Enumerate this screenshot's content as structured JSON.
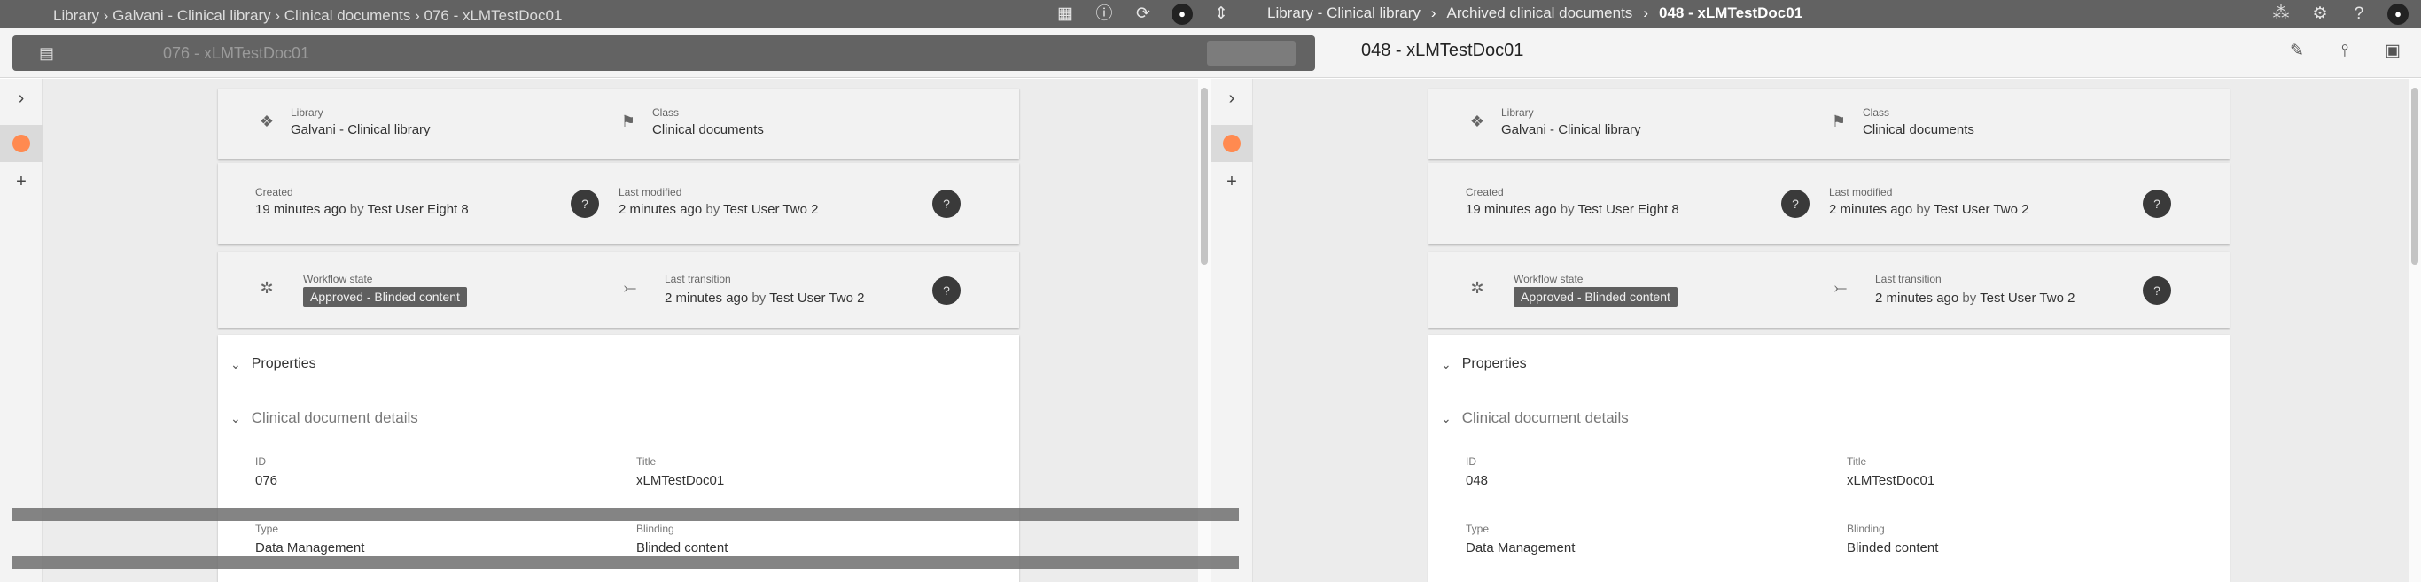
{
  "topbar": {
    "left_breadcrumb": "Library  ›  Galvani - Clinical library  ›  Clinical documents  ›  076 - xLMTestDoc01",
    "crumbs": [
      "Library - Clinical library",
      "Archived clinical documents",
      "048 - xLMTestDoc01"
    ],
    "separator": "›",
    "icons_mid": [
      "grid-icon",
      "info-icon",
      "refresh-icon",
      "avatar-icon",
      "up-down-icon"
    ],
    "icons_right": [
      "apps-icon",
      "settings-icon",
      "help-icon",
      "user-avatar-icon"
    ]
  },
  "subbar": {
    "left_title": "076 - xLMTestDoc01",
    "right_title": "048 - xLMTestDoc01",
    "right_icons": [
      "edit-icon",
      "pin-icon",
      "layout-icon"
    ]
  },
  "left_rail": {
    "buttons": [
      "›",
      "●",
      "+"
    ]
  },
  "right_rail": {
    "buttons": [
      "›",
      "●",
      "+"
    ]
  },
  "panes": [
    {
      "library_label": "Library",
      "library_value": "Galvani - Clinical library",
      "class_label": "Class",
      "class_value": "Clinical documents",
      "created_label": "Created",
      "created_value": "19 minutes ago",
      "created_by": "by",
      "created_user": "Test User Eight 8",
      "modified_label": "Last modified",
      "modified_value": "2 minutes ago",
      "modified_by": "by",
      "modified_user": "Test User Two 2",
      "workflow_label": "Workflow state",
      "workflow_value": "Approved - Blinded content",
      "transition_label": "Last transition",
      "transition_value": "2 minutes ago",
      "transition_by": "by",
      "transition_user": "Test User Two 2",
      "properties_label": "Properties",
      "details_label": "Clinical document details",
      "id_label": "ID",
      "id_value": "076",
      "title_label": "Title",
      "title_value": "xLMTestDoc01",
      "type_label": "Type",
      "type_value": "Data Management",
      "blinding_label": "Blinding",
      "blinding_value": "Blinded content"
    },
    {
      "library_label": "Library",
      "library_value": "Galvani - Clinical library",
      "class_label": "Class",
      "class_value": "Clinical documents",
      "created_label": "Created",
      "created_value": "19 minutes ago",
      "created_by": "by",
      "created_user": "Test User Eight 8",
      "modified_label": "Last modified",
      "modified_value": "2 minutes ago",
      "modified_by": "by",
      "modified_user": "Test User Two 2",
      "workflow_label": "Workflow state",
      "workflow_value": "Approved - Blinded content",
      "transition_label": "Last transition",
      "transition_value": "2 minutes ago",
      "transition_by": "by",
      "transition_user": "Test User Two 2",
      "properties_label": "Properties",
      "details_label": "Clinical document details",
      "id_label": "ID",
      "id_value": "048",
      "title_label": "Title",
      "title_value": "xLMTestDoc01",
      "type_label": "Type",
      "type_value": "Data Management",
      "blinding_label": "Blinding",
      "blinding_value": "Blinded content"
    }
  ],
  "colors": {
    "topbar": "#626262",
    "accent_dot": "#ff8a50",
    "workflow_tag": "#5f5f5f"
  }
}
